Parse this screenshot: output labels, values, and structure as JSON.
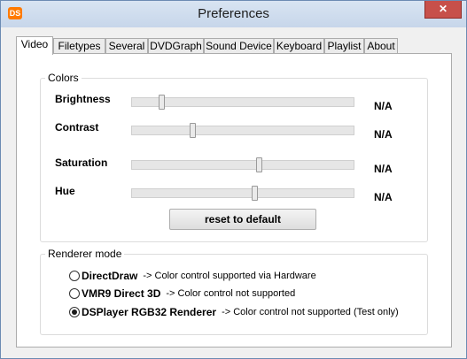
{
  "window": {
    "title": "Preferences",
    "app_icon_text": "DS",
    "close_glyph": "✕"
  },
  "tabs": [
    {
      "label": "Video"
    },
    {
      "label": "Filetypes"
    },
    {
      "label": "Several"
    },
    {
      "label": "DVDGraph"
    },
    {
      "label": "Sound Device"
    },
    {
      "label": "Keyboard"
    },
    {
      "label": "Playlist"
    },
    {
      "label": "About"
    }
  ],
  "colors_group": {
    "title": "Colors",
    "sliders": [
      {
        "label": "Brightness",
        "value_text": "N/A",
        "position": 0.13
      },
      {
        "label": "Contrast",
        "value_text": "N/A",
        "position": 0.27
      },
      {
        "label": "Saturation",
        "value_text": "N/A",
        "position": 0.57
      },
      {
        "label": "Hue",
        "value_text": "N/A",
        "position": 0.55
      }
    ],
    "reset_label": "reset to default"
  },
  "renderer_group": {
    "title": "Renderer mode",
    "options": [
      {
        "label": "DirectDraw",
        "note": "-> Color control supported via Hardware",
        "checked": false
      },
      {
        "label": "VMR9 Direct 3D",
        "note": "-> Color control not supported",
        "checked": false
      },
      {
        "label": "DSPlayer RGB32 Renderer",
        "note": "-> Color control not supported (Test only)",
        "checked": true
      }
    ]
  }
}
